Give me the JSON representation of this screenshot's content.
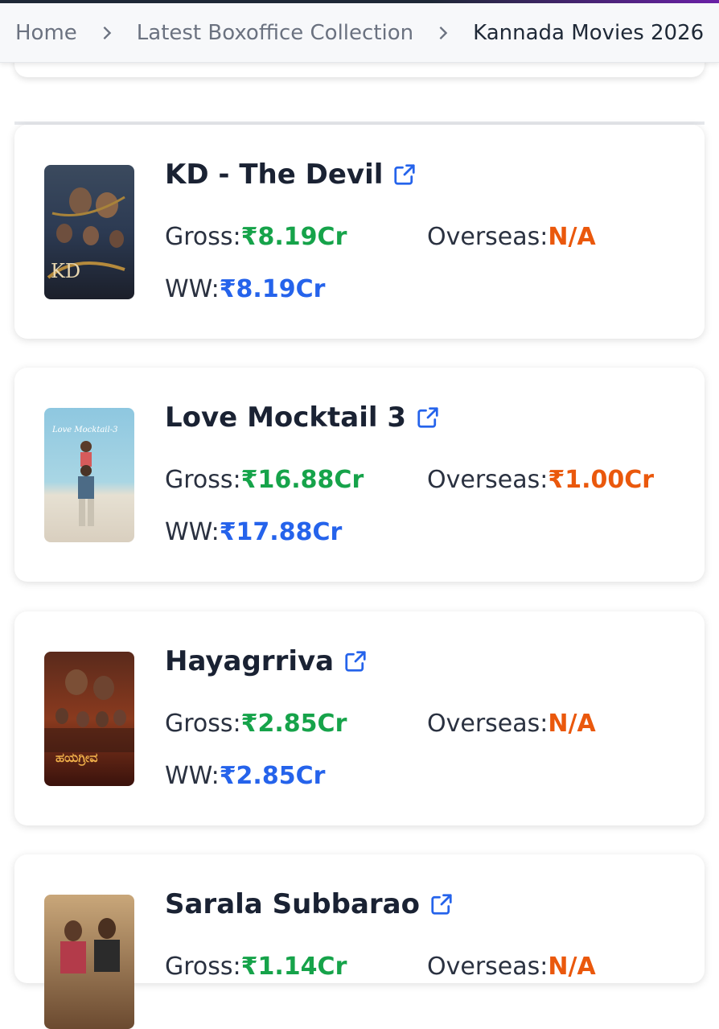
{
  "breadcrumb": {
    "items": [
      "Home",
      "Latest Boxoffice Collection",
      "Kannada Movies 2026"
    ]
  },
  "labels": {
    "gross": "Gross:",
    "overseas": "Overseas:",
    "ww": "WW:"
  },
  "colors": {
    "gross": "#16a34a",
    "overseas": "#ea580c",
    "ww": "#2563eb",
    "link_icon": "#2563eb"
  },
  "movies": [
    {
      "title": "KD - The Devil",
      "gross": "₹8.19Cr",
      "overseas": "N/A",
      "ww": "₹8.19Cr",
      "poster_text": "KD"
    },
    {
      "title": "Love Mocktail 3",
      "gross": "₹16.88Cr",
      "overseas": "₹1.00Cr",
      "ww": "₹17.88Cr",
      "poster_text": "Love Mocktail-3"
    },
    {
      "title": "Hayagrriva",
      "gross": "₹2.85Cr",
      "overseas": "N/A",
      "ww": "₹2.85Cr",
      "poster_text": "ಹಯಗ್ರೀವ"
    },
    {
      "title": "Sarala Subbarao",
      "gross": "₹1.14Cr",
      "overseas": "N/A",
      "ww": "",
      "poster_text": ""
    }
  ]
}
